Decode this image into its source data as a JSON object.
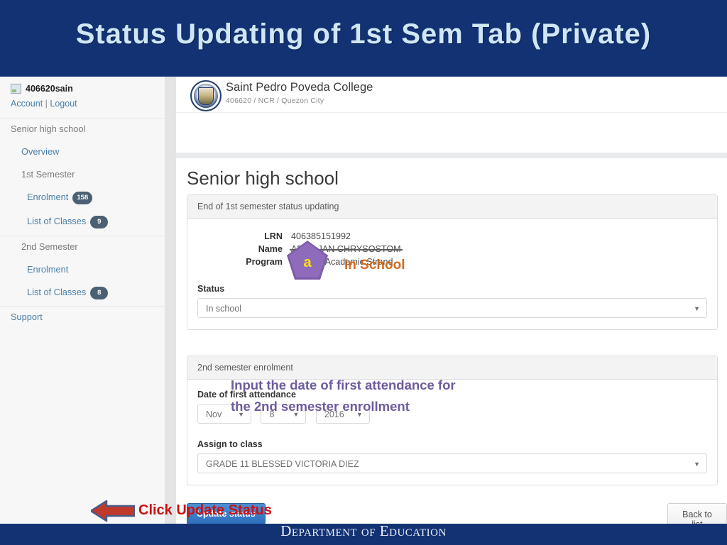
{
  "slide": {
    "title": "Status Updating of 1st Sem Tab (Private)",
    "banner_color": "#123274",
    "title_color": "#cfe6f5",
    "footer_text": "Department of Education"
  },
  "sidebar": {
    "user": {
      "avatar_icon": "user-thumbnail-icon",
      "username": "406620sain",
      "account_link": "Account",
      "separator": "|",
      "logout_link": "Logout"
    },
    "sections": [
      {
        "header": "Senior high school",
        "items": [
          {
            "label": "Overview",
            "level": 1,
            "badge": null
          },
          {
            "label": "1st Semester",
            "level": 1,
            "badge": null,
            "is_head": true
          },
          {
            "label": "Enrolment",
            "level": 2,
            "badge": "158"
          },
          {
            "label": "List of Classes",
            "level": 2,
            "badge": "9"
          }
        ]
      },
      {
        "header": null,
        "items": [
          {
            "label": "2nd Semester",
            "level": 1,
            "badge": null,
            "is_head": true
          },
          {
            "label": "Enrolment",
            "level": 2,
            "badge": null
          },
          {
            "label": "List of Classes",
            "level": 2,
            "badge": "8"
          }
        ]
      },
      {
        "header": null,
        "items": [
          {
            "label": "Support",
            "level": 0,
            "badge": null
          }
        ]
      }
    ]
  },
  "school_header": {
    "logo_icon": "school-seal-icon",
    "name": "Saint Pedro Poveda College",
    "meta": "406620 / NCR / Quezon City"
  },
  "main": {
    "page_title": "Senior high school",
    "status_panel": {
      "heading": "End of 1st semester status updating",
      "fields": [
        {
          "key": "LRN",
          "value": "406385151992",
          "redacted": false
        },
        {
          "key": "Name",
          "value": "ABAT, JAN CHRYSOSTOM",
          "redacted": true
        },
        {
          "key": "Program",
          "value": "General Academic Strand",
          "redacted": false
        }
      ],
      "status_label": "Status",
      "status_value": "In school",
      "caret_icon": "chevron-down-icon"
    },
    "second_sem_panel": {
      "heading": "2nd semester enrolment",
      "date_label": "Date of first attendance",
      "date_month": "Nov",
      "date_day": "8",
      "date_year": "2016",
      "class_label": "Assign to class",
      "class_value": "GRADE 11 BLESSED VICTORIA DIEZ",
      "caret_icon": "chevron-down-icon"
    },
    "actions": {
      "update_button": "Update status",
      "back_button": "Back to list"
    }
  },
  "annotations": {
    "marker_letter": "a",
    "marker_color": "#8e6cbb",
    "marker_letter_color": "#ffe400",
    "in_school": "In School",
    "in_school_color": "#d2691e",
    "input_date_line1": "Input the date of first attendance for",
    "input_date_line2": "the 2nd semester enrollment",
    "input_date_color": "#6e5b9e",
    "click_update": "Click Update Status",
    "click_update_color": "#cc1111",
    "arrow_icon": "left-arrow-icon"
  }
}
